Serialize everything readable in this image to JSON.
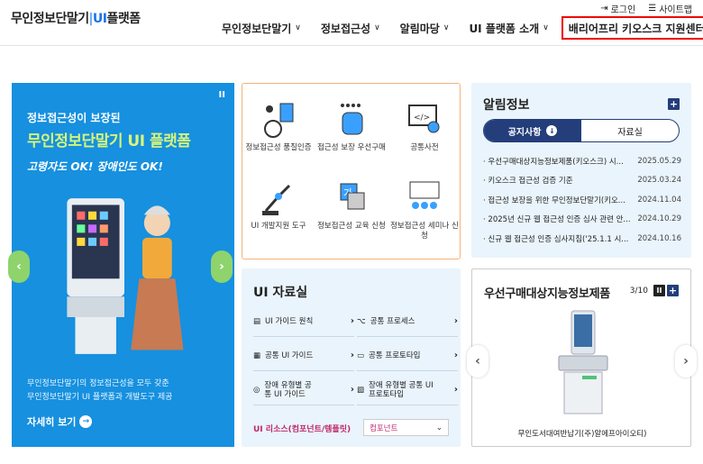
{
  "header": {
    "logo_main": "무인정보단말기",
    "logo_ui": "UI",
    "logo_tail": "플랫폼"
  },
  "util": {
    "login": "로그인",
    "sitemap": "사이트맵"
  },
  "gnb": [
    {
      "label": "무인정보단말기"
    },
    {
      "label": "정보접근성"
    },
    {
      "label": "알림마당"
    },
    {
      "label": "UI 플랫폼 소개"
    },
    {
      "label": "배리어프리 키오스크 지원센터"
    }
  ],
  "banner": {
    "title_small": "정보접근성이 보장된",
    "title_big": "무인정보단말기 UI 플랫폼",
    "tagline": "고령자도 OK! 장애인도 OK!",
    "desc1": "무인정보단말기의 정보접근성을 모두 갖춘",
    "desc2": "무인정보단말기 UI 플랫폼과 개발도구 제공",
    "more": "자세히 보기",
    "pause": "II"
  },
  "services": [
    {
      "label": "정보접근성 품질인증"
    },
    {
      "label": "접근성 보장 우선구매"
    },
    {
      "label": "공통사전"
    },
    {
      "label": "UI 개발지원 도구"
    },
    {
      "label": "정보접근성 교육 신청"
    },
    {
      "label": "정보접근성 세미나 신청"
    }
  ],
  "notice": {
    "title": "알림정보",
    "tab_notice": "공지사항",
    "tab_data": "자료실",
    "items": [
      {
        "title": "우선구매대상지능정보제품(키오스크) 시...",
        "date": "2025.05.29"
      },
      {
        "title": "키오스크 접근성 검증 기준",
        "date": "2025.03.24"
      },
      {
        "title": "접근성 보장을 위한 무인정보단말기(키오...",
        "date": "2024.11.04"
      },
      {
        "title": "2025년 신규 웹 접근성 인증 심사 관련 안...",
        "date": "2024.10.29"
      },
      {
        "title": "신규 웹 접근성 인증 심사지침('25.1.1 시...",
        "date": "2024.10.16"
      }
    ]
  },
  "uires": {
    "title": "UI 자료실",
    "items": [
      {
        "label": "UI 가이드 원칙"
      },
      {
        "label": "공통 프로세스"
      },
      {
        "label": "공통 UI 가이드"
      },
      {
        "label": "공통 프로토타입"
      },
      {
        "label": "장애 유형별 공통 UI 가이드"
      },
      {
        "label": "장애 유형별 공통 UI 프로토타입"
      }
    ],
    "resource_label": "UI 리소스(컴포넌트/템플릿)",
    "resource_select": "컴포넌트"
  },
  "product": {
    "title": "우선구매대상지능정보제품",
    "counter": "3/10",
    "caption": "무인도서대여반납기(주)알에프아이오티)"
  },
  "colors": {
    "accent": "#1a73e8",
    "banner_bg": "#1690df",
    "navy": "#233e7a",
    "highlight_border": "#e00000"
  }
}
